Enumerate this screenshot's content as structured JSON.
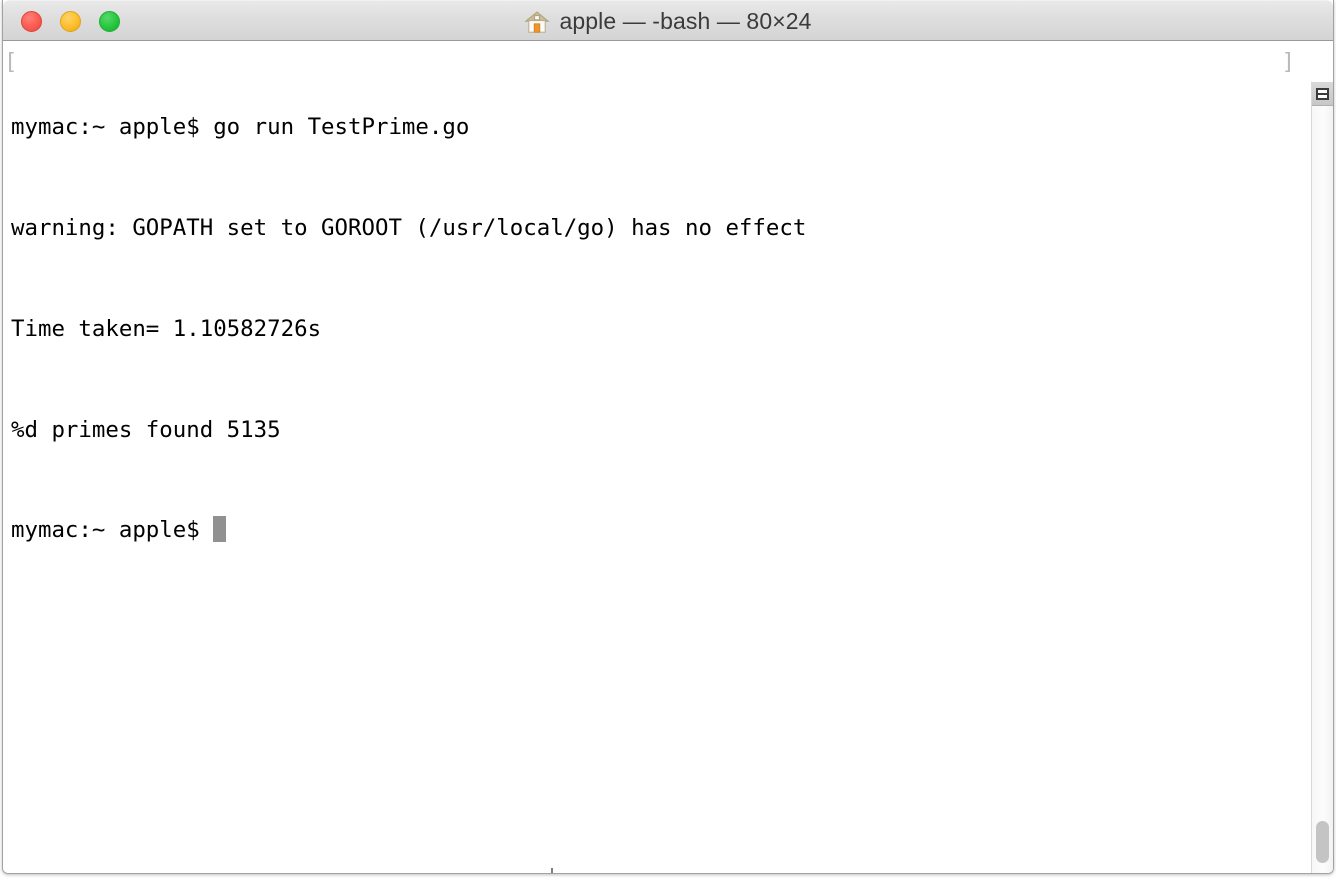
{
  "window": {
    "title": "apple — -bash — 80×24",
    "icon": "home-icon",
    "controls": {
      "close_label": "",
      "minimize_label": "",
      "maximize_label": ""
    }
  },
  "terminal": {
    "columns": 80,
    "rows": 24,
    "shell": "-bash",
    "user": "apple",
    "margin_bracket_left": "[",
    "margin_bracket_right": "]",
    "lines": [
      "mymac:~ apple$ go run TestPrime.go",
      "warning: GOPATH set to GOROOT (/usr/local/go) has no effect",
      "Time taken= 1.10582726s",
      "%d primes found 5135",
      "mymac:~ apple$ "
    ],
    "prompt": "mymac:~ apple$ ",
    "cursor": {
      "visible": true,
      "style": "block",
      "color": "#919191"
    }
  },
  "colors": {
    "titlebar_top": "#e9e9e9",
    "titlebar_bottom": "#d4d4d4",
    "close_red": "#fc5b52",
    "minimize_yellow": "#fdbe2d",
    "maximize_green": "#27c63f",
    "terminal_background": "#ffffff",
    "terminal_text": "#000000",
    "title_text": "#3b3b3b"
  },
  "scrollbar": {
    "top_button_icon": "scroll-list-icon",
    "thumb_position": "bottom"
  }
}
